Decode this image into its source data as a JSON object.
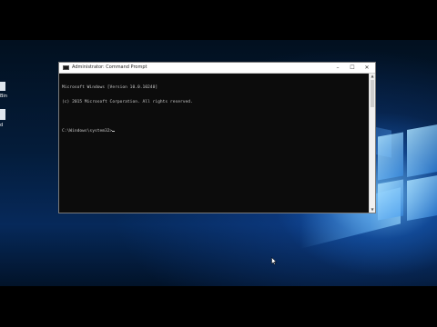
{
  "window": {
    "title": "Administrator: Command Prompt",
    "controls": {
      "minimize": "–",
      "maximize": "☐",
      "close": "✕"
    }
  },
  "console": {
    "line1": "Microsoft Windows [Version 10.0.10240]",
    "line2": "(c) 2015 Microsoft Corporation. All rights reserved.",
    "prompt": "C:\\Windows\\system32>"
  },
  "desktop": {
    "icon1_label": "Bin",
    "icon2_label": "d"
  },
  "icons": {
    "app": "cmd-icon",
    "pointer": "mouse-pointer-icon"
  },
  "colors": {
    "console_bg": "#0c0c0c",
    "console_text": "#c8c8c8",
    "titlebar": "#ffffff",
    "desktop_accent": "#1e6ed2"
  }
}
